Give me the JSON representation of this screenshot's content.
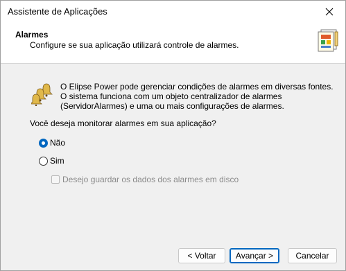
{
  "window": {
    "title": "Assistente de Aplicações"
  },
  "header": {
    "title": "Alarmes",
    "subtitle": "Configure se sua aplicação utilizará controle de alarmes."
  },
  "description": {
    "line1": "O Elipse Power pode gerenciar condições de alarmes em diversas fontes.",
    "line2": "O sistema funciona com um objeto centralizador de alarmes",
    "line3": "(ServidorAlarmes) e uma ou mais configurações de alarmes."
  },
  "question": "Você deseja monitorar alarmes em sua aplicação?",
  "options": {
    "no_label": "Não",
    "yes_label": "Sim",
    "selected": "Não"
  },
  "save_to_disk": {
    "label": "Desejo guardar os dados dos alarmes em disco",
    "checked": false,
    "enabled": false
  },
  "buttons": {
    "back": "< Voltar",
    "next": "Avançar >",
    "cancel": "Cancelar"
  },
  "colors": {
    "accent": "#0067c0",
    "disabled_text": "#8a8a8a"
  },
  "icons": {
    "close": "close-icon",
    "header": "wizard-icon",
    "alarms": "alarm-bells-icon"
  }
}
